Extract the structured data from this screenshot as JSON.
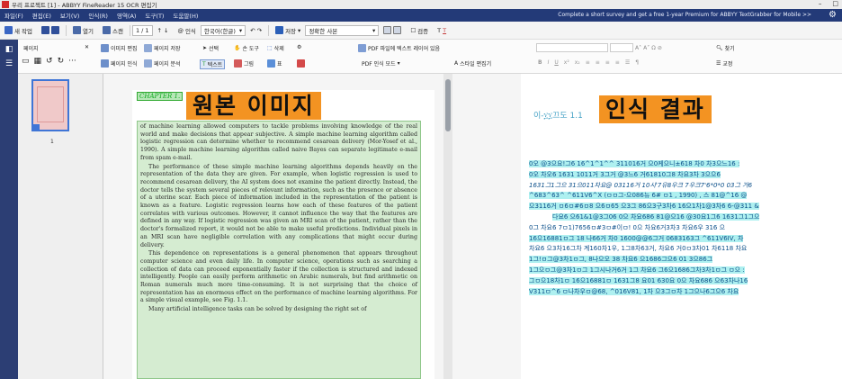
{
  "window": {
    "title": "우리 프로젝트 [1] - ABBYY FineReader 15 OCR 편집기",
    "minimize": "–",
    "maximize": "□"
  },
  "menu": {
    "items": [
      "파일(F)",
      "편집(E)",
      "보기(V)",
      "인식(R)",
      "영역(A)",
      "도구(T)",
      "도움말(H)"
    ],
    "promo": "Complete a short survey and get a free 1-year Premium for ABBYY TextGrabber for Mobile >>",
    "gear": "⚙"
  },
  "toolbar": {
    "new_task": "새 작업",
    "open": "열기",
    "scan": "스캔",
    "page_indicator": "1 / 1",
    "recognize": "인식",
    "language": "한국어(한글)",
    "save": "저장",
    "accuracy": "정확한 사본",
    "verify": "검증"
  },
  "ribbon": {
    "pages_label": "페이지",
    "edit_image": "이미지 편집",
    "page_save": "페이지 저장",
    "select": "선택",
    "hand_tool": "손 도구",
    "delete": "삭제",
    "recognize_page": "페이지 인식",
    "page_analysis": "페이지 분석",
    "text": "텍스트",
    "picture": "그림",
    "table": "표",
    "pdf_layer": "PDF 파일에 텍스트 레이어 있음",
    "pdf_mode": "PDF 인식 모드",
    "style_editor": "스타일 편집기",
    "find": "찾기",
    "proofread": "교정"
  },
  "pages_panel": {
    "thumb_number": "1"
  },
  "image_panel": {
    "chapter": "CHAPTER 1.",
    "overlay": "원본 이미지",
    "paragraphs": [
      "of machine learning allowed computers to tackle problems involving knowledge of the real world and make decisions that appear subjective. A simple machine learning algorithm called logistic regression can determine whether to recommend cesarean delivery (Mor-Yosef et al., 1990). A simple machine learning algorithm called naive Bayes can separate legitimate e-mail from spam e-mail.",
      "The performance of these simple machine learning algorithms depends heavily on the representation of the data they are given. For example, when logistic regression is used to recommend cesarean delivery, the AI system does not examine the patient directly. Instead, the doctor tells the system several pieces of relevant information, such as the presence or absence of a uterine scar. Each piece of information included in the representation of the patient is known as a feature. Logistic regression learns how each of these features of the patient correlates with various outcomes. However, it cannot influence the way that the features are defined in any way. If logistic regression was given an MRI scan of the patient, rather than the doctor's formalized report, it would not be able to make useful predictions. Individual pixels in an MRI scan have negligible correlation with any complications that might occur during delivery.",
      "This dependence on representations is a general phenomenon that appears throughout computer science and even daily life. In computer science, operations such as searching a collection of data can proceed exponentially faster if the collection is structured and indexed intelligently. People can easily perform arithmetic on Arabic numerals, but find arithmetic on Roman numerals much more time-consuming. It is not surprising that the choice of representation has an enormous effect on the performance of machine learning algorithms. For a simple visual example, see Fig. 1.1.",
      "Many artificial intelligence tasks can be solved by designing the right set of"
    ]
  },
  "result_panel": {
    "heading": "이-፲፲끄도 1.1",
    "overlay": "인식 결과",
    "lines": [
      "0오 @3으요!그6 16^1^1^^ 311016거 으0케으니±618 차0 차3으느16 :",
      "0오 차오6 1631 1011거 3그거 @3느6 거61810그8 차요3차 3으으6",
      "1631그1그으 31으011차요@ 03116거 10시'7유8우크 7우크7'6*0*0 03그 거6",
      "^683^63^ ^611V6^X  (ㅁㅁ그-으086뉴 6# ㅁ1 , 1990) , 스 81@^16 @",
      "으3116거 ㅁ6ㅁ#6ㅁ8 으6ㅁ65 으3그 86으3구3차6 16으1차1@3차6 6-@311 &",
      "다요6 으61&1@3그06 0으 차요686 81@으16 @30요1그6 1631그1그으",
      "0그 차요6  7ㅁ1)7656ㅁ#3ㅁ#이ㅁ! 0으  차요6거3차3 차요6우    316     으",
      "16으16881ㅁ그 18 나66거 차0 1600@@6그거 0683163그 ^611V6IV, 차",
      "차요6 으3차16그차 계160차1우, 1그8차63거, 차요6 거0ㅁ3차01 차6118 차요",
      "1그!ㅁ그@3차1ㅁ그, 8나으오 38     차요6   으1686그으6      01 3으86그",
      "1그으ㅁ그@3차1ㅁ그 1그시나거6거 1그 차요6 그6으1686그차3차1ㅁ그 ㅁ으 :",
      "그ㅁ으18차1ㅁ 16으16881ㅁ 1631그8 요01 630요 0으 차요686 으63차나16",
      "V311ㅁ^6 ㅁ나차우ㅁ@68, ^016V81, 1차 으3그ㅁ차 1그으나6그으6 차요"
    ]
  }
}
